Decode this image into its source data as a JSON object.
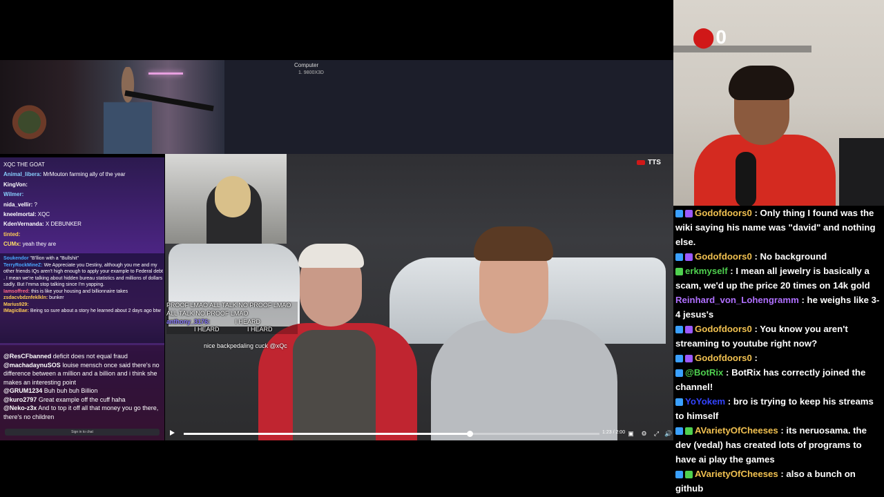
{
  "computer_panel": {
    "title": "Computer",
    "item": "1.  9800X3D"
  },
  "counter": {
    "icon": "stop-icon",
    "value": "0"
  },
  "tts_label": "TTS",
  "chat_left_top": [
    {
      "user": "",
      "text": "XQC THE GOAT",
      "color": "#ffffff"
    },
    {
      "user": "Animal_libera:",
      "text": " MrMouton farming ally of the year",
      "color": "#88d0ff"
    },
    {
      "user": "KingVon:",
      "text": "",
      "color": "#ffffff"
    },
    {
      "user": "Wilmer:",
      "text": "",
      "color": "#88d0ff"
    },
    {
      "user": "nida_vellir:",
      "text": " ?",
      "color": "#ffffff"
    },
    {
      "user": "kneelmortal:",
      "text": " XQC",
      "color": "#ffffff"
    },
    {
      "user": "KdenVernanda:",
      "text": " X DEBUNKER",
      "color": "#ffffff"
    },
    {
      "user": "tinted:",
      "text": "",
      "color": "#ffcc55"
    },
    {
      "user": "CUMx:",
      "text": " yeah they are",
      "color": "#ffe066"
    }
  ],
  "chat_left_mid": [
    {
      "user": "Soukendor",
      "text": " \"B'llion with a \"Bullshit\"",
      "color": "#4aa8ff"
    },
    {
      "user": "TerryRockMineZ:",
      "text": " We Appreciate you Destiny, although you me and my other friends IQs aren't high enough to apply your example to Federal debt . I mean we're talking about hidden bureau statistics and millions of dollars sadly. But I'mma stop talking since I'm yapping.",
      "color": "#4aa8ff"
    },
    {
      "user": "Iamsoffred:",
      "text": " this is like your housing and billionnaire takes",
      "color": "#ff6a8a"
    },
    {
      "user": "zsdacvbdznfeklkln:",
      "text": " bunker",
      "color": "#ffcc55"
    },
    {
      "user": "Marius929:",
      "text": "",
      "color": "#ffcc55"
    },
    {
      "user": "IMagicBae:",
      "text": " Being so sure about a story he learned about 2 days ago btw",
      "color": "#ffcc55"
    }
  ],
  "chat_left_bottom": [
    {
      "user": "@ResCFbanned",
      "text": " deficit does not equal fraud"
    },
    {
      "user": "@machadaynuSOS",
      "text": " louise mensch once said there's no difference between a million and a billion and i think she makes an interesting point"
    },
    {
      "user": "@GRUM1234",
      "text": " Buh buh buh Billion"
    },
    {
      "user": "@kuro2797",
      "text": " Great example off the cuff haha"
    },
    {
      "user": "@Neko-z3x",
      "text": " And to top it off all that money you go there, there's no children"
    }
  ],
  "signin_label": "Sign in to chat",
  "overlay_chat": {
    "line1": "PROOF LMAO ALL TALK NO PROOF LMAO",
    "line2": "ALL TALK NO PROOF LMAO",
    "user1": "anthony_3176:",
    "text1": "I HEARD",
    "text2": "I HEARD",
    "text3": "I HEARD",
    "backpedal": "nice backpedaling cuck @xQc"
  },
  "video": {
    "time": "1:23 / 2:00",
    "progress": 0.687,
    "controls": [
      "settings-icon",
      "fullscreen-exit-icon",
      "volume-icon",
      "subtitles-icon"
    ]
  },
  "chat_right": [
    {
      "user": "Godofdoors0",
      "text": " : Only thing I found was the wiki saying his name was \"david\" and nothing else.",
      "color": "#f0c050",
      "badges": [
        "#3aa0ff",
        "#9b59ff"
      ]
    },
    {
      "user": "Godofdoors0",
      "text": " : No background",
      "color": "#f0c050",
      "badges": [
        "#3aa0ff",
        "#9b59ff"
      ]
    },
    {
      "user": "erkmyself",
      "text": " : I mean all jewelry is basically a scam, we'd up the price 20 times on 14k gold",
      "color": "#4fd04f",
      "badges": [
        "#4fd04f"
      ]
    },
    {
      "user": "Reinhard_von_Lohengramm",
      "text": " : he weighs like 3-4 jesus's",
      "color": "#b070ff",
      "badges": []
    },
    {
      "user": "Godofdoors0",
      "text": " : You know you aren't streaming to youtube right now?",
      "color": "#f0c050",
      "badges": [
        "#3aa0ff",
        "#9b59ff"
      ]
    },
    {
      "user": "Godofdoors0",
      "text": " :",
      "color": "#f0c050",
      "badges": [
        "#3aa0ff",
        "#9b59ff"
      ]
    },
    {
      "user": "@BotRix",
      "text": " : BotRix has correctly joined the channel!",
      "color": "#4fd04f",
      "badges": [
        "#3aa0ff"
      ]
    },
    {
      "user": "YoYokem",
      "text": " : bro is trying to keep his streams to himself",
      "color": "#3344ff",
      "badges": [
        "#3aa0ff"
      ]
    },
    {
      "user": "AVarietyOfCheeses",
      "text": " : its neruosama. the dev (vedal) has created lots of programs to have ai play the games",
      "color": "#f0c050",
      "badges": [
        "#3aa0ff",
        "#4fd04f"
      ]
    },
    {
      "user": "AVarietyOfCheeses",
      "text": " : also a bunch on github",
      "color": "#f0c050",
      "badges": [
        "#3aa0ff",
        "#4fd04f"
      ]
    }
  ]
}
